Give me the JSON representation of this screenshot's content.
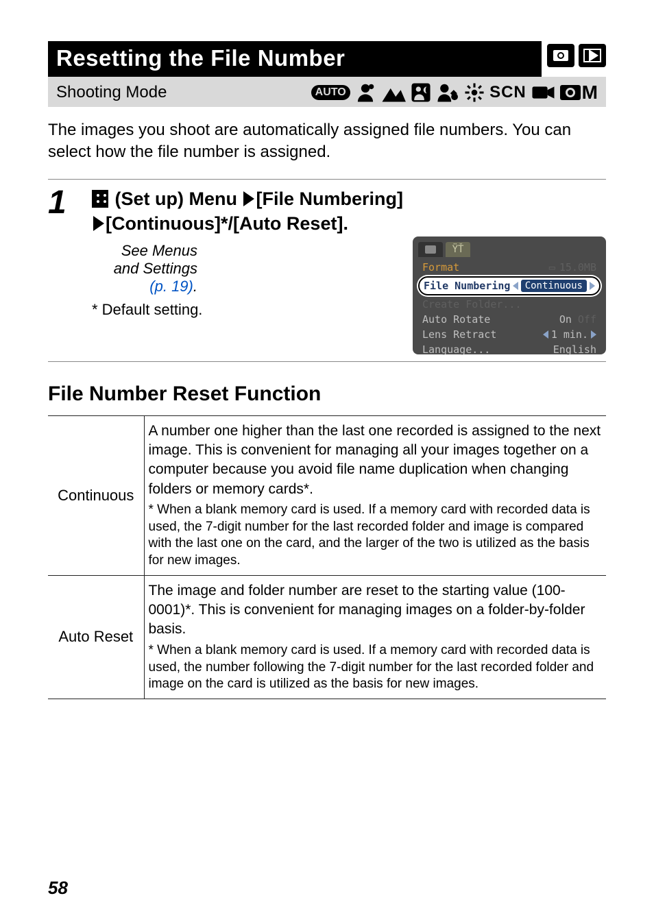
{
  "title": "Resetting the File Number",
  "shooting_mode_label": "Shooting Mode",
  "mode_icons": {
    "auto": "AUTO",
    "scn": "SCN",
    "m_suffix": "M"
  },
  "intro": "The images you shoot are automatically assigned file numbers. You can select how the file number is assigned.",
  "step": {
    "number": "1",
    "setup_label": " (Set up) Menu ",
    "file_numbering": "[File Numbering] ",
    "continuous_auto": "[Continuous]*/[Auto Reset].",
    "see_menus_pre": "See Menus and Settings ",
    "see_menus_link": "(p. 19)",
    "see_menus_post": ".",
    "default_setting": "* Default setting."
  },
  "lcd": {
    "format_label": "Format",
    "format_value": "15.0MB",
    "file_numbering_label": "File Numbering",
    "file_numbering_value": "Continuous",
    "create_folder": "Create Folder...",
    "auto_rotate_label": "Auto Rotate",
    "auto_rotate_on": "On",
    "auto_rotate_off": "Off",
    "lens_retract_label": "Lens Retract",
    "lens_retract_value": "1 min.",
    "language_label": "Language...",
    "language_value": "English"
  },
  "section_heading": "File Number Reset Function",
  "table": {
    "continuous": {
      "label": "Continuous",
      "body": "A number one higher than the last one recorded is assigned to the next image. This is convenient for managing all your images together on a computer because you avoid file name duplication when changing folders or memory cards*.",
      "foot": "* When a blank memory card is used. If a memory card with recorded data is used, the 7-digit number for the last recorded folder and image is compared with the last one on the card, and the larger of the two is utilized as the basis for new images."
    },
    "auto_reset": {
      "label": "Auto Reset",
      "body": "The image and folder number are reset to the starting value (100-0001)*. This is convenient for managing images on a folder-by-folder basis.",
      "foot": "* When a blank memory card is used. If a memory card with recorded data is used, the number following the 7-digit number for the last recorded folder and image on the card is utilized as the basis for new images."
    }
  },
  "page_number": "58"
}
